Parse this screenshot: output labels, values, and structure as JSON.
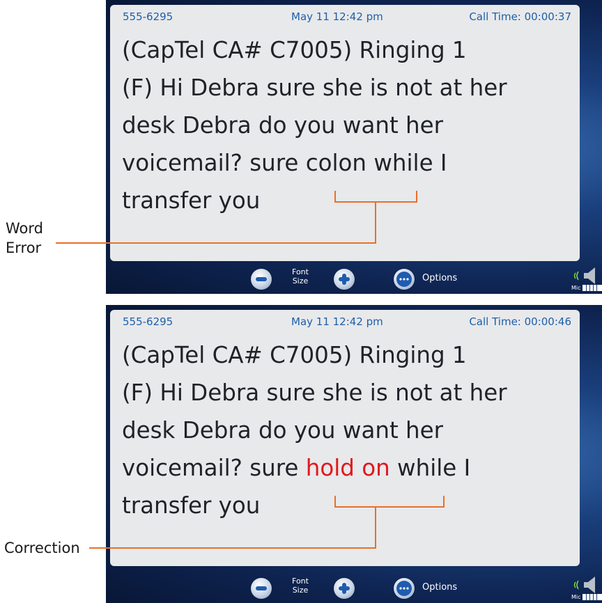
{
  "annotations": {
    "word_error": [
      "Word",
      "Error"
    ],
    "correction": "Correction"
  },
  "screens": [
    {
      "header": {
        "number": "555-6295",
        "datetime": "May  11 12:42  pm",
        "call_time": "Call Time:  00:00:37"
      },
      "lines": [
        [
          {
            "t": " (CapTel CA# C7005) Ringing 1"
          }
        ],
        [
          {
            "t": "(F) Hi Debra sure she is not at her"
          }
        ],
        [
          {
            "t": "desk Debra do you want her"
          }
        ],
        [
          {
            "t": "voicemail?  sure "
          },
          {
            "t": "colon"
          },
          {
            "t": " while I"
          }
        ],
        [
          {
            "t": "transfer you"
          }
        ]
      ],
      "toolbar": {
        "font_size": [
          "Font",
          "Size"
        ],
        "options": "Options",
        "mic": "Mic"
      }
    },
    {
      "header": {
        "number": "555-6295",
        "datetime": "May  11 12:42  pm",
        "call_time": "Call Time:  00:00:46"
      },
      "lines": [
        [
          {
            "t": " (CapTel CA# C7005) Ringing 1"
          }
        ],
        [
          {
            "t": "(F) Hi Debra sure she is not at her"
          }
        ],
        [
          {
            "t": "desk Debra do you want her"
          }
        ],
        [
          {
            "t": "voicemail?  sure "
          },
          {
            "t": "hold on",
            "highlight": true
          },
          {
            "t": " while I"
          }
        ],
        [
          {
            "t": "transfer you"
          }
        ]
      ],
      "toolbar": {
        "font_size": [
          "Font",
          "Size"
        ],
        "options": "Options",
        "mic": "Mic"
      }
    }
  ],
  "colors": {
    "accent_line": "#e8702a",
    "correction_text": "#e0191d",
    "header_text": "#1d5fa8"
  }
}
